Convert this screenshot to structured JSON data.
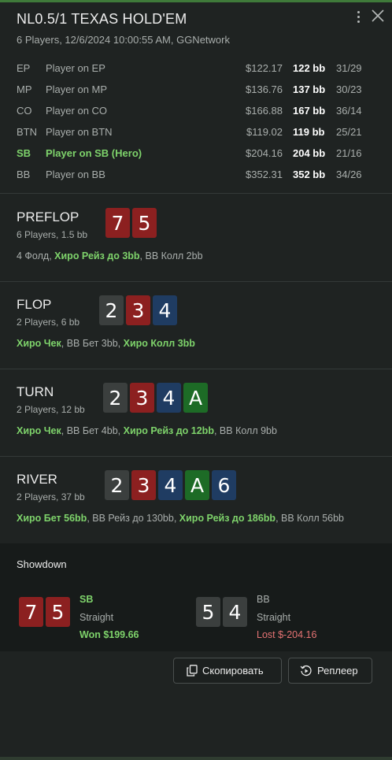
{
  "header": {
    "title": "NL0.5/1 TEXAS HOLD'EM",
    "subtitle": "6 Players, 12/6/2024 10:00:55 AM, GGNetwork"
  },
  "players": [
    {
      "pos": "EP",
      "name": "Player on EP",
      "stack": "$122.17",
      "bb": "122 bb",
      "stat": "31/29",
      "hero": false
    },
    {
      "pos": "MP",
      "name": "Player on MP",
      "stack": "$136.76",
      "bb": "137 bb",
      "stat": "30/23",
      "hero": false
    },
    {
      "pos": "CO",
      "name": "Player on CO",
      "stack": "$166.88",
      "bb": "167 bb",
      "stat": "36/14",
      "hero": false
    },
    {
      "pos": "BTN",
      "name": "Player on BTN",
      "stack": "$119.02",
      "bb": "119 bb",
      "stat": "25/21",
      "hero": false
    },
    {
      "pos": "SB",
      "name": "Player on SB (Hero)",
      "stack": "$204.16",
      "bb": "204 bb",
      "stat": "21/16",
      "hero": true
    },
    {
      "pos": "BB",
      "name": "Player on BB",
      "stack": "$352.31",
      "bb": "352 bb",
      "stat": "34/26",
      "hero": false
    }
  ],
  "streets": {
    "preflop": {
      "name": "PREFLOP",
      "info": "6 Players, 1.5 bb",
      "cards": [
        {
          "rank": "7",
          "suit": "h"
        },
        {
          "rank": "5",
          "suit": "h"
        }
      ],
      "actions": [
        {
          "text": "4 Фолд",
          "hero": false
        },
        {
          "text": "Хиро Рейз до 3bb",
          "hero": true
        },
        {
          "text": "BB Колл 2bb",
          "hero": false
        }
      ]
    },
    "flop": {
      "name": "FLOP",
      "info": "2 Players, 6 bb",
      "cards": [
        {
          "rank": "2",
          "suit": "s"
        },
        {
          "rank": "3",
          "suit": "h"
        },
        {
          "rank": "4",
          "suit": "d"
        }
      ],
      "actions": [
        {
          "text": "Хиро Чек",
          "hero": true
        },
        {
          "text": "BB Бет 3bb",
          "hero": false
        },
        {
          "text": "Хиро Колл 3bb",
          "hero": true
        }
      ]
    },
    "turn": {
      "name": "TURN",
      "info": "2 Players, 12 bb",
      "cards": [
        {
          "rank": "2",
          "suit": "s"
        },
        {
          "rank": "3",
          "suit": "h"
        },
        {
          "rank": "4",
          "suit": "d"
        },
        {
          "rank": "A",
          "suit": "c"
        }
      ],
      "actions": [
        {
          "text": "Хиро Чек",
          "hero": true
        },
        {
          "text": "BB Бет 4bb",
          "hero": false
        },
        {
          "text": "Хиро Рейз до 12bb",
          "hero": true
        },
        {
          "text": "BB Колл 9bb",
          "hero": false
        }
      ]
    },
    "river": {
      "name": "RIVER",
      "info": "2 Players, 37 bb",
      "cards": [
        {
          "rank": "2",
          "suit": "s"
        },
        {
          "rank": "3",
          "suit": "h"
        },
        {
          "rank": "4",
          "suit": "d"
        },
        {
          "rank": "A",
          "suit": "c"
        },
        {
          "rank": "6",
          "suit": "d"
        }
      ],
      "actions": [
        {
          "text": "Хиро Бет 56bb",
          "hero": true
        },
        {
          "text": "BB Рейз до 130bb",
          "hero": false
        },
        {
          "text": "Хиро Рейз до 186bb",
          "hero": true
        },
        {
          "text": "BB Колл 56bb",
          "hero": false
        }
      ]
    }
  },
  "showdown": {
    "title": "Showdown",
    "hero": {
      "cards": [
        {
          "rank": "7",
          "suit": "h"
        },
        {
          "rank": "5",
          "suit": "h"
        }
      ],
      "pos": "SB",
      "hand": "Straight",
      "result": "Won $199.66"
    },
    "villain": {
      "cards": [
        {
          "rank": "5",
          "suit": "s"
        },
        {
          "rank": "4",
          "suit": "s"
        }
      ],
      "pos": "BB",
      "hand": "Straight",
      "result": "Lost $-204.16"
    }
  },
  "buttons": {
    "copy": "Скопировать",
    "replayer": "Реплеер"
  },
  "icons": {
    "menu": "kebab-menu-icon",
    "close": "close-icon",
    "copy": "copy-icon",
    "replayer": "replay-icon"
  },
  "colors": {
    "hero_green": "#7ed36b",
    "lost_red": "#e57373",
    "hearts": "#8c2020",
    "spades": "#3b3f3e",
    "diamonds": "#1f3c62",
    "clubs": "#1d6b26"
  }
}
